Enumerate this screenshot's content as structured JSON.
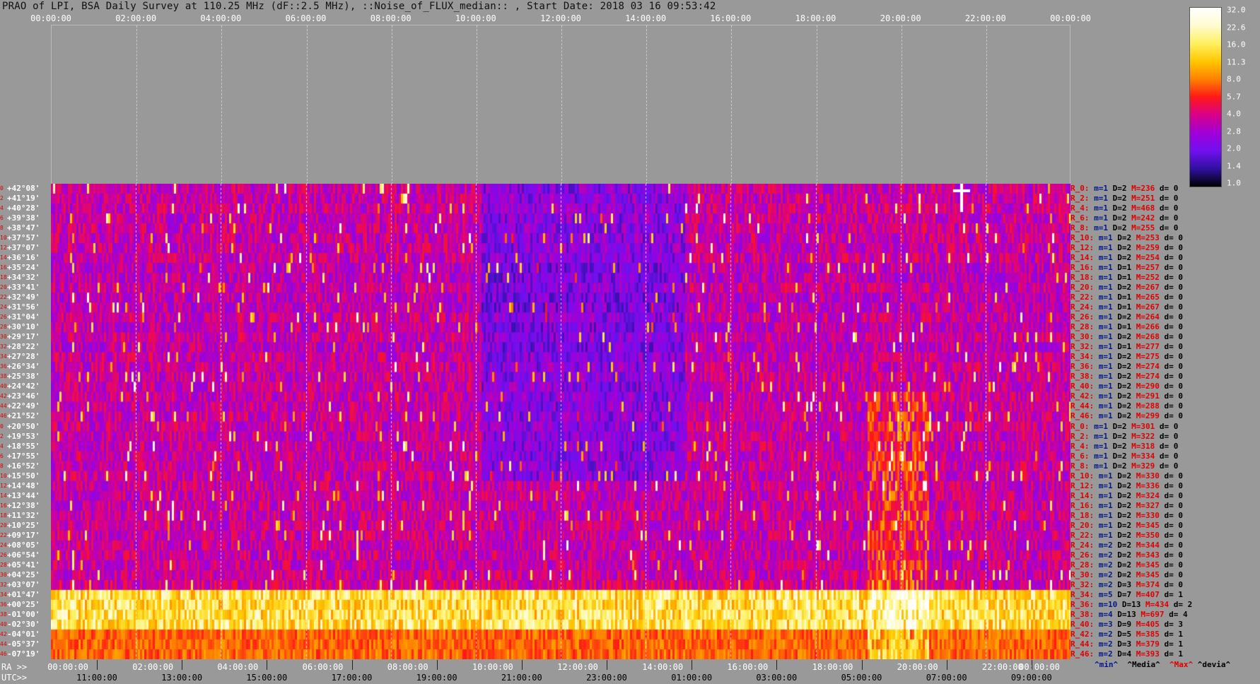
{
  "header": {
    "title": "PRAO of LPI, BSA Daily Survey at 110.25 MHz (dF::2.5 MHz), ::Noise_of_FLUX_median:: , Start Date: 2018 03 16 09:53:42"
  },
  "ra_axis_label": "RA >>",
  "utc_axis_label": "UTC>>",
  "top_ticks": [
    "00:00:00",
    "02:00:00",
    "04:00:00",
    "06:00:00",
    "08:00:00",
    "10:00:00",
    "12:00:00",
    "14:00:00",
    "16:00:00",
    "18:00:00",
    "20:00:00",
    "22:00:00",
    "00:00:00"
  ],
  "bottom_ra_ticks": [
    "00:00:00",
    "02:00:00",
    "04:00:00",
    "06:00:00",
    "08:00:00",
    "10:00:00",
    "12:00:00",
    "14:00:00",
    "16:00:00",
    "18:00:00",
    "20:00:00",
    "22:00:00",
    "00:00:00"
  ],
  "utc_ticks": [
    "11:00:00",
    "13:00:00",
    "15:00:00",
    "17:00:00",
    "19:00:00",
    "21:00:00",
    "23:00:00",
    "01:00:00",
    "03:00:00",
    "05:00:00",
    "07:00:00",
    "09:00:00"
  ],
  "colorbar": {
    "ticks": [
      "32.0",
      "22.6",
      "16.0",
      "11.3",
      "8.0",
      "5.7",
      "4.0",
      "2.8",
      "2.0",
      "1.4",
      "1.0"
    ],
    "colors": [
      "#ffffff",
      "#fffbd0",
      "#fff060",
      "#ffc800",
      "#ff8000",
      "#ff1818",
      "#d8008a",
      "#a000d8",
      "#7010f0",
      "#3010a0",
      "#000000"
    ]
  },
  "legend": {
    "min": "^min^",
    "median": "^Media^",
    "max": "^Max^",
    "devia": "^devia^"
  },
  "chart_data": {
    "type": "heatmap",
    "title": "PRAO of LPI, BSA Daily Survey at 110.25 MHz (dF::2.5 MHz), ::Noise_of_FLUX_median:: , Start Date: 2018 03 16 09:53:42",
    "x_axis": "RA",
    "x_range": [
      "00:00:00",
      "24:00:00"
    ],
    "colorbar_range": [
      1.0,
      32.0
    ],
    "colorbar_scale": "log",
    "rows": [
      {
        "idx": "0",
        "dec": "+42°08'",
        "ray": "R_0:",
        "min": 1,
        "D": 2,
        "M": 236,
        "d": 0
      },
      {
        "idx": "2",
        "dec": "+41°19'",
        "ray": "R_2:",
        "min": 1,
        "D": 2,
        "M": 251,
        "d": 0
      },
      {
        "idx": "4",
        "dec": "+40°28'",
        "ray": "R_4:",
        "min": 1,
        "D": 2,
        "M": 468,
        "d": 0
      },
      {
        "idx": "6",
        "dec": "+39°38'",
        "ray": "R_6:",
        "min": 1,
        "D": 2,
        "M": 242,
        "d": 0
      },
      {
        "idx": "8",
        "dec": "+38°47'",
        "ray": "R_8:",
        "min": 1,
        "D": 2,
        "M": 255,
        "d": 0
      },
      {
        "idx": "10",
        "dec": "+37°57'",
        "ray": "R_10:",
        "min": 1,
        "D": 2,
        "M": 253,
        "d": 0
      },
      {
        "idx": "12",
        "dec": "+37°07'",
        "ray": "R_12:",
        "min": 1,
        "D": 2,
        "M": 259,
        "d": 0
      },
      {
        "idx": "14",
        "dec": "+36°16'",
        "ray": "R_14:",
        "min": 1,
        "D": 2,
        "M": 254,
        "d": 0
      },
      {
        "idx": "16",
        "dec": "+35°24'",
        "ray": "R_16:",
        "min": 1,
        "D": 1,
        "M": 257,
        "d": 0
      },
      {
        "idx": "18",
        "dec": "+34°32'",
        "ray": "R_18:",
        "min": 1,
        "D": 1,
        "M": 252,
        "d": 0
      },
      {
        "idx": "20",
        "dec": "+33°41'",
        "ray": "R_20:",
        "min": 1,
        "D": 2,
        "M": 267,
        "d": 0
      },
      {
        "idx": "22",
        "dec": "+32°49'",
        "ray": "R_22:",
        "min": 1,
        "D": 1,
        "M": 265,
        "d": 0
      },
      {
        "idx": "24",
        "dec": "+31°56'",
        "ray": "R_24:",
        "min": 1,
        "D": 1,
        "M": 267,
        "d": 0
      },
      {
        "idx": "26",
        "dec": "+31°04'",
        "ray": "R_26:",
        "min": 1,
        "D": 2,
        "M": 264,
        "d": 0
      },
      {
        "idx": "28",
        "dec": "+30°10'",
        "ray": "R_28:",
        "min": 1,
        "D": 1,
        "M": 266,
        "d": 0
      },
      {
        "idx": "30",
        "dec": "+29°17'",
        "ray": "R_30:",
        "min": 1,
        "D": 2,
        "M": 268,
        "d": 0
      },
      {
        "idx": "32",
        "dec": "+28°22'",
        "ray": "R_32:",
        "min": 1,
        "D": 1,
        "M": 277,
        "d": 0
      },
      {
        "idx": "34",
        "dec": "+27°28'",
        "ray": "R_34:",
        "min": 1,
        "D": 2,
        "M": 275,
        "d": 0
      },
      {
        "idx": "36",
        "dec": "+26°34'",
        "ray": "R_36:",
        "min": 1,
        "D": 2,
        "M": 274,
        "d": 0
      },
      {
        "idx": "38",
        "dec": "+25°38'",
        "ray": "R_38:",
        "min": 1,
        "D": 2,
        "M": 274,
        "d": 0
      },
      {
        "idx": "40",
        "dec": "+24°42'",
        "ray": "R_40:",
        "min": 1,
        "D": 2,
        "M": 290,
        "d": 0
      },
      {
        "idx": "42",
        "dec": "+23°46'",
        "ray": "R_42:",
        "min": 1,
        "D": 2,
        "M": 291,
        "d": 0
      },
      {
        "idx": "44",
        "dec": "+22°49'",
        "ray": "R_44:",
        "min": 1,
        "D": 2,
        "M": 288,
        "d": 0
      },
      {
        "idx": "46",
        "dec": "+21°52'",
        "ray": "R_46:",
        "min": 1,
        "D": 2,
        "M": 299,
        "d": 0
      },
      {
        "idx": "0",
        "dec": "+20°50'",
        "ray": "R_0:",
        "min": 1,
        "D": 2,
        "M": 301,
        "d": 0
      },
      {
        "idx": "2",
        "dec": "+19°53'",
        "ray": "R_2:",
        "min": 1,
        "D": 2,
        "M": 322,
        "d": 0
      },
      {
        "idx": "4",
        "dec": "+18°55'",
        "ray": "R_4:",
        "min": 1,
        "D": 2,
        "M": 318,
        "d": 0
      },
      {
        "idx": "6",
        "dec": "+17°55'",
        "ray": "R_6:",
        "min": 1,
        "D": 2,
        "M": 334,
        "d": 0
      },
      {
        "idx": "8",
        "dec": "+16°52'",
        "ray": "R_8:",
        "min": 1,
        "D": 2,
        "M": 329,
        "d": 0
      },
      {
        "idx": "10",
        "dec": "+15°50'",
        "ray": "R_10:",
        "min": 1,
        "D": 2,
        "M": 330,
        "d": 0
      },
      {
        "idx": "12",
        "dec": "+14°48'",
        "ray": "R_12:",
        "min": 1,
        "D": 2,
        "M": 336,
        "d": 0
      },
      {
        "idx": "14",
        "dec": "+13°44'",
        "ray": "R_14:",
        "min": 1,
        "D": 2,
        "M": 324,
        "d": 0
      },
      {
        "idx": "16",
        "dec": "+12°38'",
        "ray": "R_16:",
        "min": 1,
        "D": 2,
        "M": 327,
        "d": 0
      },
      {
        "idx": "18",
        "dec": "+11°32'",
        "ray": "R_18:",
        "min": 1,
        "D": 2,
        "M": 330,
        "d": 0
      },
      {
        "idx": "20",
        "dec": "+10°25'",
        "ray": "R_20:",
        "min": 1,
        "D": 2,
        "M": 345,
        "d": 0
      },
      {
        "idx": "22",
        "dec": "+09°17'",
        "ray": "R_22:",
        "min": 1,
        "D": 2,
        "M": 350,
        "d": 0
      },
      {
        "idx": "24",
        "dec": "+08°05'",
        "ray": "R_24:",
        "min": 2,
        "D": 2,
        "M": 344,
        "d": 0
      },
      {
        "idx": "26",
        "dec": "+06°54'",
        "ray": "R_26:",
        "min": 2,
        "D": 2,
        "M": 343,
        "d": 0
      },
      {
        "idx": "28",
        "dec": "+05°41'",
        "ray": "R_28:",
        "min": 2,
        "D": 2,
        "M": 345,
        "d": 0
      },
      {
        "idx": "30",
        "dec": "+04°25'",
        "ray": "R_30:",
        "min": 2,
        "D": 2,
        "M": 345,
        "d": 0
      },
      {
        "idx": "32",
        "dec": "+03°07'",
        "ray": "R_32:",
        "min": 2,
        "D": 3,
        "M": 374,
        "d": 0
      },
      {
        "idx": "34",
        "dec": "+01°47'",
        "ray": "R_34:",
        "min": 5,
        "D": 7,
        "M": 407,
        "d": 1
      },
      {
        "idx": "36",
        "dec": "+00°25'",
        "ray": "R_36:",
        "min": 10,
        "D": 13,
        "M": 434,
        "d": 2
      },
      {
        "idx": "38",
        "dec": "-01°00'",
        "ray": "R_38:",
        "min": 4,
        "D": 13,
        "M": 697,
        "d": 4
      },
      {
        "idx": "40",
        "dec": "-02°30'",
        "ray": "R_40:",
        "min": 3,
        "D": 9,
        "M": 405,
        "d": 3
      },
      {
        "idx": "42",
        "dec": "-04°01'",
        "ray": "R_42:",
        "min": 2,
        "D": 5,
        "M": 385,
        "d": 1
      },
      {
        "idx": "44",
        "dec": "-05°37'",
        "ray": "R_44:",
        "min": 2,
        "D": 3,
        "M": 379,
        "d": 1
      },
      {
        "idx": "46",
        "dec": "-07°19'",
        "ray": "R_46:",
        "min": 2,
        "D": 4,
        "M": 393,
        "d": 1
      }
    ]
  }
}
